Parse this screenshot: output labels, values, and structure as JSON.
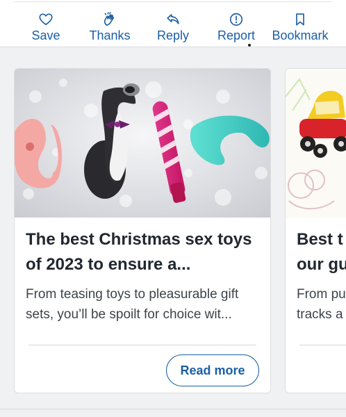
{
  "actions": [
    {
      "label": "Save",
      "icon": "heart-icon"
    },
    {
      "label": "Thanks",
      "icon": "clapping-hands-icon"
    },
    {
      "label": "Reply",
      "icon": "reply-arrow-icon"
    },
    {
      "label": "Report",
      "icon": "alert-circle-icon"
    },
    {
      "label": "Bookmark",
      "icon": "bookmark-icon"
    }
  ],
  "cards": [
    {
      "title": "The best Christmas sex toys of 2023 to ensure a...",
      "description": "From teasing toys to pleasurable gift sets, you’ll be spoilt for choice wit...",
      "button": "Read more"
    },
    {
      "title": "Best t",
      "title_line2": "our gu",
      "description": "From pu",
      "description_line2": "tracks a"
    }
  ],
  "colors": {
    "accent": "#1a5fa6",
    "text": "#222830",
    "background": "#f0f1f3"
  }
}
